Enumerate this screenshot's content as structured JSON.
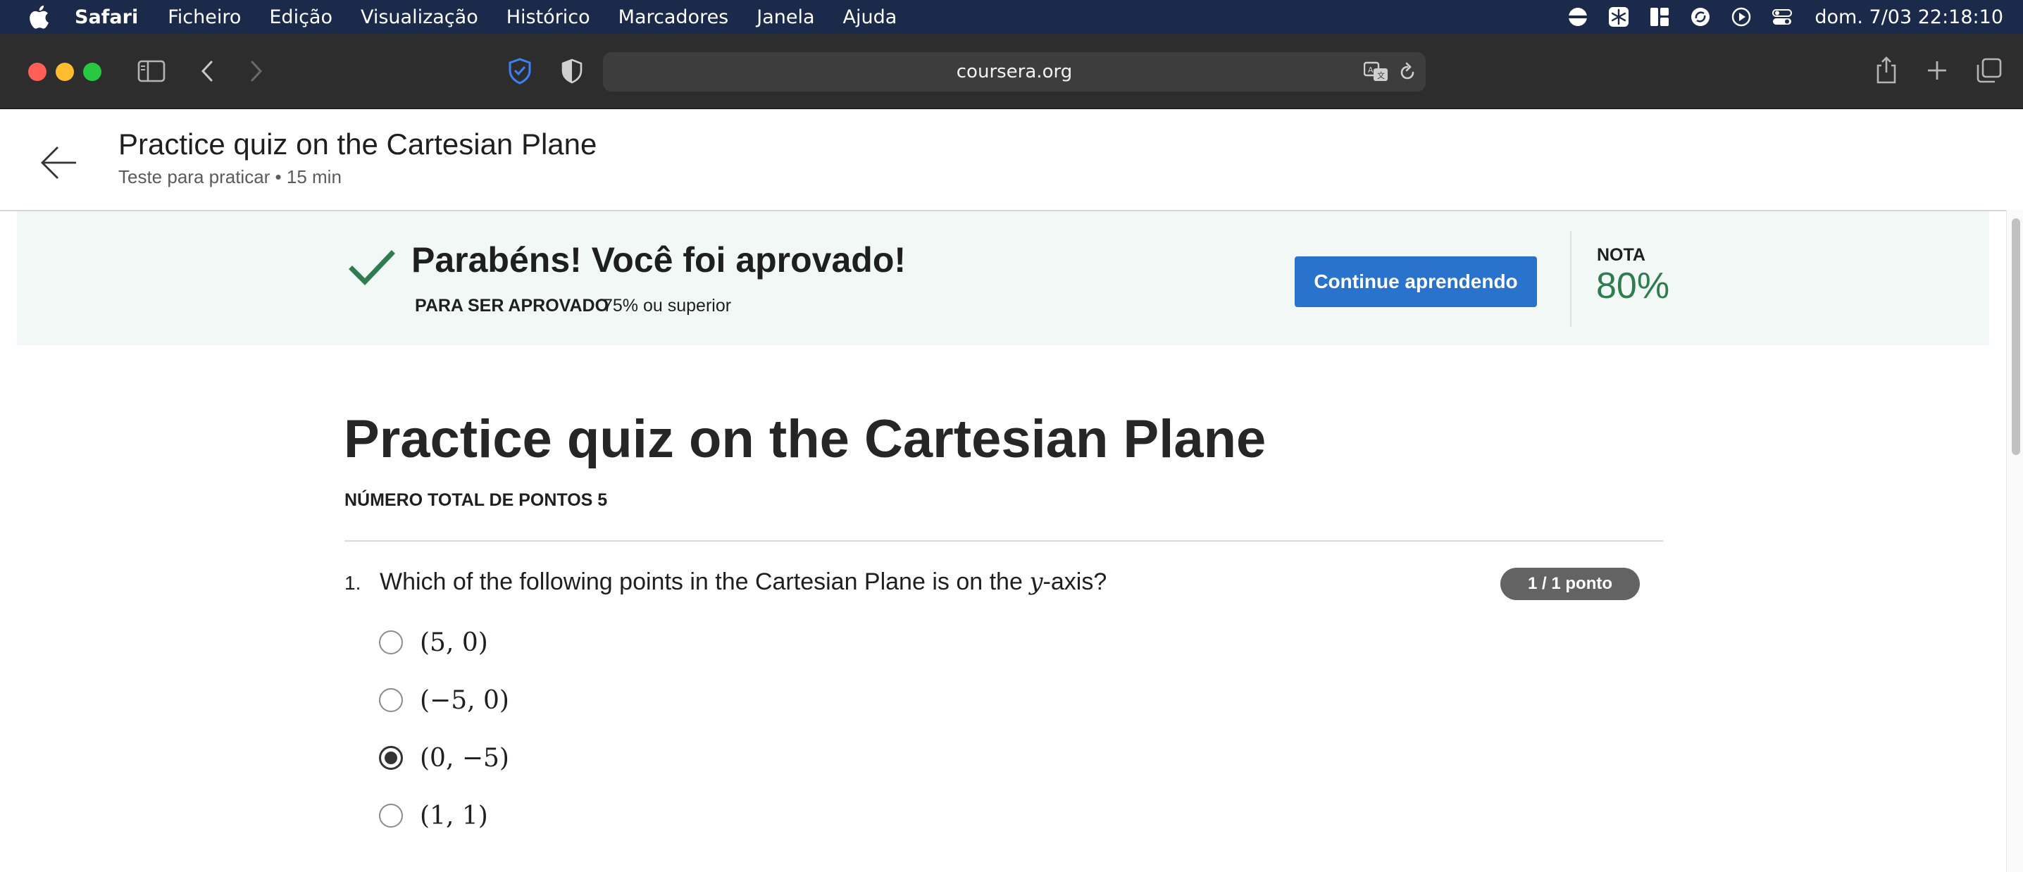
{
  "menubar": {
    "app_name": "Safari",
    "items": [
      "Ficheiro",
      "Edição",
      "Visualização",
      "Histórico",
      "Marcadores",
      "Janela",
      "Ajuda"
    ],
    "clock": "dom. 7/03  22:18:10",
    "status_icons": [
      "display-icon",
      "snowflake-icon",
      "layout-icon",
      "sync-icon",
      "play-icon",
      "control-center-icon"
    ]
  },
  "browser": {
    "url": "coursera.org",
    "colors": {
      "close": "#ff5f57",
      "minimize": "#febc2e",
      "maximize": "#28c840",
      "shield": "#3a82f7"
    }
  },
  "header": {
    "title": "Practice quiz on the Cartesian Plane",
    "subtitle": "Teste para praticar • 15 min"
  },
  "banner": {
    "message": "Parabéns! Você foi aprovado!",
    "requirement_label": "PARA SER APROVADO",
    "requirement_value": "75% ou superior",
    "continue_label": "Continue aprendendo",
    "grade_label": "NOTA",
    "grade_value": "80%",
    "colors": {
      "background": "#f1f8f6",
      "check": "#2f7c4f",
      "button": "#2a73cc"
    }
  },
  "quiz": {
    "title": "Practice quiz on the Cartesian Plane",
    "total_points": "NÚMERO TOTAL DE PONTOS 5",
    "question": {
      "number": "1.",
      "text_before": "Which of the following points in the Cartesian Plane is on the ",
      "math_var": "y",
      "text_after": "-axis?",
      "points_badge": "1 / 1 ponto",
      "options": [
        {
          "label": "(5, 0)",
          "selected": false
        },
        {
          "label": "(−5, 0)",
          "selected": false
        },
        {
          "label": "(0, −5)",
          "selected": true
        },
        {
          "label": "(1, 1)",
          "selected": false
        }
      ]
    }
  }
}
